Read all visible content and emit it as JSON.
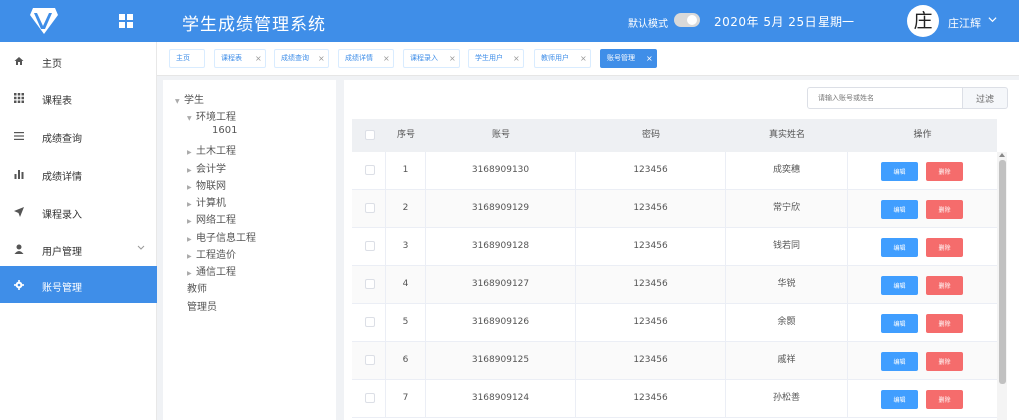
{
  "header": {
    "title": "学生成绩管理系统",
    "dark_mode_label": "默认模式",
    "date": "2020年 5月 25日",
    "weekday": "星期一",
    "avatar_char": "庄",
    "username": "庄江辉",
    "bg_color": "#3f8ee8"
  },
  "sidebar": {
    "items": [
      {
        "label": "主页",
        "icon": "home-icon"
      },
      {
        "label": "课程表",
        "icon": "table-icon"
      },
      {
        "label": "成绩查询",
        "icon": "list-icon"
      },
      {
        "label": "成绩详情",
        "icon": "bar-chart-icon"
      },
      {
        "label": "课程录入",
        "icon": "send-icon"
      },
      {
        "label": "用户管理",
        "icon": "user-icon"
      },
      {
        "label": "账号管理",
        "icon": "gear-icon",
        "active": true
      }
    ]
  },
  "tabs": [
    {
      "label": "主页"
    },
    {
      "label": "课程表"
    },
    {
      "label": "成绩查询"
    },
    {
      "label": "成绩详情"
    },
    {
      "label": "课程录入"
    },
    {
      "label": "学生用户"
    },
    {
      "label": "教师用户"
    },
    {
      "label": "账号管理",
      "active": true
    }
  ],
  "tree": {
    "root": "学生",
    "nodes": [
      {
        "label": "环境工程",
        "expanded": true
      },
      {
        "label": "1601"
      },
      {
        "label": "土木工程"
      },
      {
        "label": "会计学"
      },
      {
        "label": "物联网"
      },
      {
        "label": "计算机"
      },
      {
        "label": "网络工程"
      },
      {
        "label": "电子信息工程"
      },
      {
        "label": "工程造价"
      },
      {
        "label": "通信工程"
      }
    ],
    "teacher": "教师",
    "admin": "管理员"
  },
  "search": {
    "placeholder": "请输入账号或姓名",
    "button": "过滤"
  },
  "table": {
    "columns": [
      "序号",
      "账号",
      "密码",
      "真实姓名",
      "操作"
    ],
    "edit_label": "编辑",
    "delete_label": "删除",
    "rows": [
      {
        "no": "1",
        "account": "3168909130",
        "password": "123456",
        "name": "成奕穗"
      },
      {
        "no": "2",
        "account": "3168909129",
        "password": "123456",
        "name": "常宁欣"
      },
      {
        "no": "3",
        "account": "3168909128",
        "password": "123456",
        "name": "钱若同"
      },
      {
        "no": "4",
        "account": "3168909127",
        "password": "123456",
        "name": "华锐"
      },
      {
        "no": "5",
        "account": "3168909126",
        "password": "123456",
        "name": "余颢"
      },
      {
        "no": "6",
        "account": "3168909125",
        "password": "123456",
        "name": "戚祥"
      },
      {
        "no": "7",
        "account": "3168909124",
        "password": "123456",
        "name": "孙松善"
      }
    ]
  }
}
